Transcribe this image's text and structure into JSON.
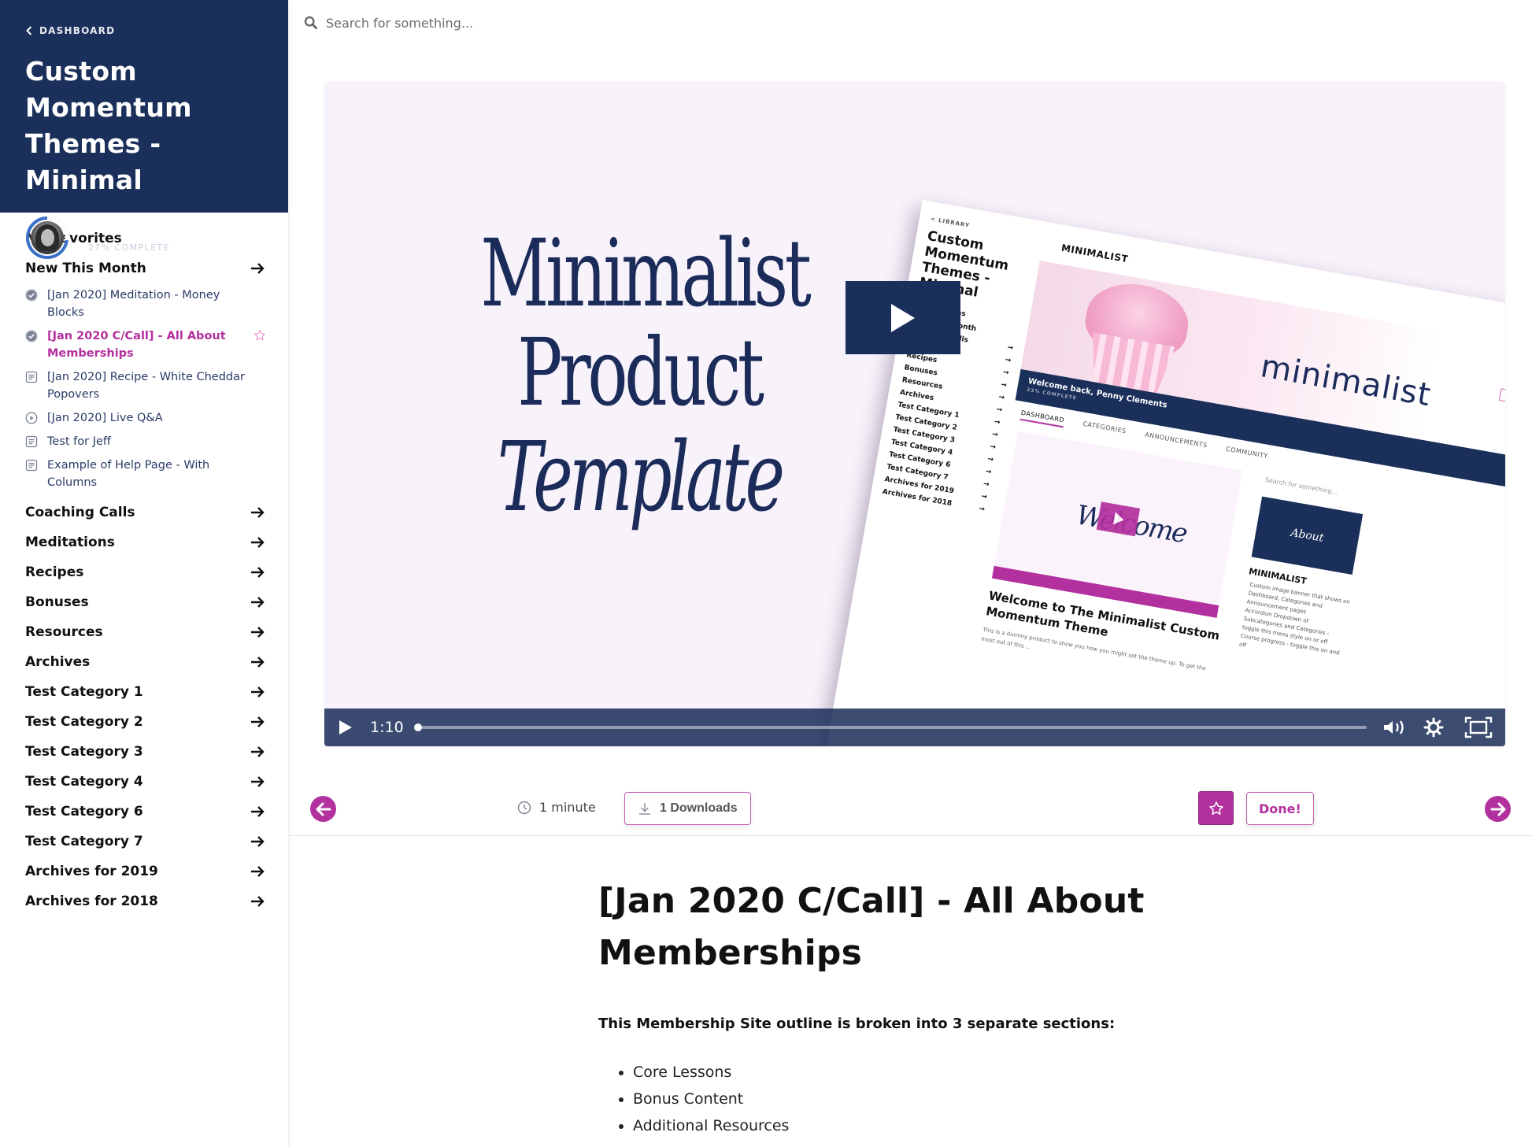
{
  "sidebar": {
    "back_label": "DASHBOARD",
    "course_title": "Custom Momentum Themes - Minimal",
    "user": {
      "name": "Penny Clements",
      "progress_label": "27% COMPLETE",
      "progress_fraction": 0.27
    },
    "sections": [
      {
        "label": "My Favorites",
        "has_arrow": false
      },
      {
        "label": "New This Month",
        "has_arrow": true,
        "expanded": true,
        "items": [
          {
            "label": "[Jan 2020] Meditation - Money Blocks",
            "icon": "check-circle-icon",
            "active": false
          },
          {
            "label": "[Jan 2020 C/Call] - All About Memberships",
            "icon": "check-circle-icon",
            "active": true,
            "favorite_icon": "star-outline-icon"
          },
          {
            "label": "[Jan 2020] Recipe - White Cheddar Popovers",
            "icon": "document-icon",
            "active": false
          },
          {
            "label": "[Jan 2020] Live Q&A",
            "icon": "play-circle-icon",
            "active": false
          },
          {
            "label": "Test for Jeff",
            "icon": "document-icon",
            "active": false
          },
          {
            "label": "Example of Help Page - With Columns",
            "icon": "document-icon",
            "active": false
          }
        ]
      },
      {
        "label": "Coaching Calls",
        "has_arrow": true
      },
      {
        "label": "Meditations",
        "has_arrow": true
      },
      {
        "label": "Recipes",
        "has_arrow": true
      },
      {
        "label": "Bonuses",
        "has_arrow": true
      },
      {
        "label": "Resources",
        "has_arrow": true
      },
      {
        "label": "Archives",
        "has_arrow": true
      },
      {
        "label": "Test Category 1",
        "has_arrow": true
      },
      {
        "label": "Test Category 2",
        "has_arrow": true
      },
      {
        "label": "Test Category 3",
        "has_arrow": true
      },
      {
        "label": "Test Category 4",
        "has_arrow": true
      },
      {
        "label": "Test Category 6",
        "has_arrow": true
      },
      {
        "label": "Test Category 7",
        "has_arrow": true
      },
      {
        "label": "Archives for 2019",
        "has_arrow": true
      },
      {
        "label": "Archives for 2018",
        "has_arrow": true
      }
    ]
  },
  "search": {
    "placeholder": "Search for something...",
    "value": ""
  },
  "video": {
    "thumbnail": {
      "line1": "Minimalist",
      "line2": "Product",
      "line3": "Template",
      "mock": {
        "back": "< LIBRARY",
        "title": "Custom Momentum Themes - Minimal",
        "brand": "MINIMALIST",
        "wordmark": "minimalist",
        "pills": [
          "DASHBOARD",
          "CATEGORIES"
        ],
        "welcome": "Welcome back, Penny Clements",
        "welcome_sub": "23% COMPLETE",
        "tabs": [
          "DASHBOARD",
          "CATEGORIES",
          "ANNOUNCEMENTS",
          "COMMUNITY"
        ],
        "nav": [
          "My Favorites",
          "New This Month",
          "Coaching Calls",
          "Meditations",
          "Recipes",
          "Bonuses",
          "Resources",
          "Archives",
          "Test Category 1",
          "Test Category 2",
          "Test Category 3",
          "Test Category 4",
          "Test Category 6",
          "Test Category 7",
          "Archives for 2019",
          "Archives for 2018"
        ],
        "video_word": "Welcome",
        "heading": "Welcome to The Minimalist Custom Momentum Theme",
        "paragraph": "This is a dummy product to show you how you might set the theme up. To get the most out of this ...",
        "search": "Search for something...",
        "about": "About",
        "side_heading": "MINIMALIST",
        "side_list": [
          "Custom image banner that shows on Dashboard, Categories and Announcement pages",
          "Accordion Dropdown of Subcategories and Categories - toggle this menu style on or off",
          "Course progress - toggle this on and off"
        ]
      }
    },
    "current_time": "1:10",
    "progress_fraction": 0.0
  },
  "actions": {
    "duration": "1 minute",
    "downloads_label": "1 Downloads",
    "done_label": "Done!"
  },
  "article": {
    "title": "[Jan 2020 C/Call] - All About Memberships",
    "lead": "This Membership Site outline is broken into 3 separate sections:",
    "bullets": [
      "Core Lessons",
      "Bonus Content",
      "Additional Resources"
    ]
  },
  "colors": {
    "navy": "#1a2f5a",
    "accent": "#b3309f",
    "video_bg": "#f8f2fa"
  }
}
